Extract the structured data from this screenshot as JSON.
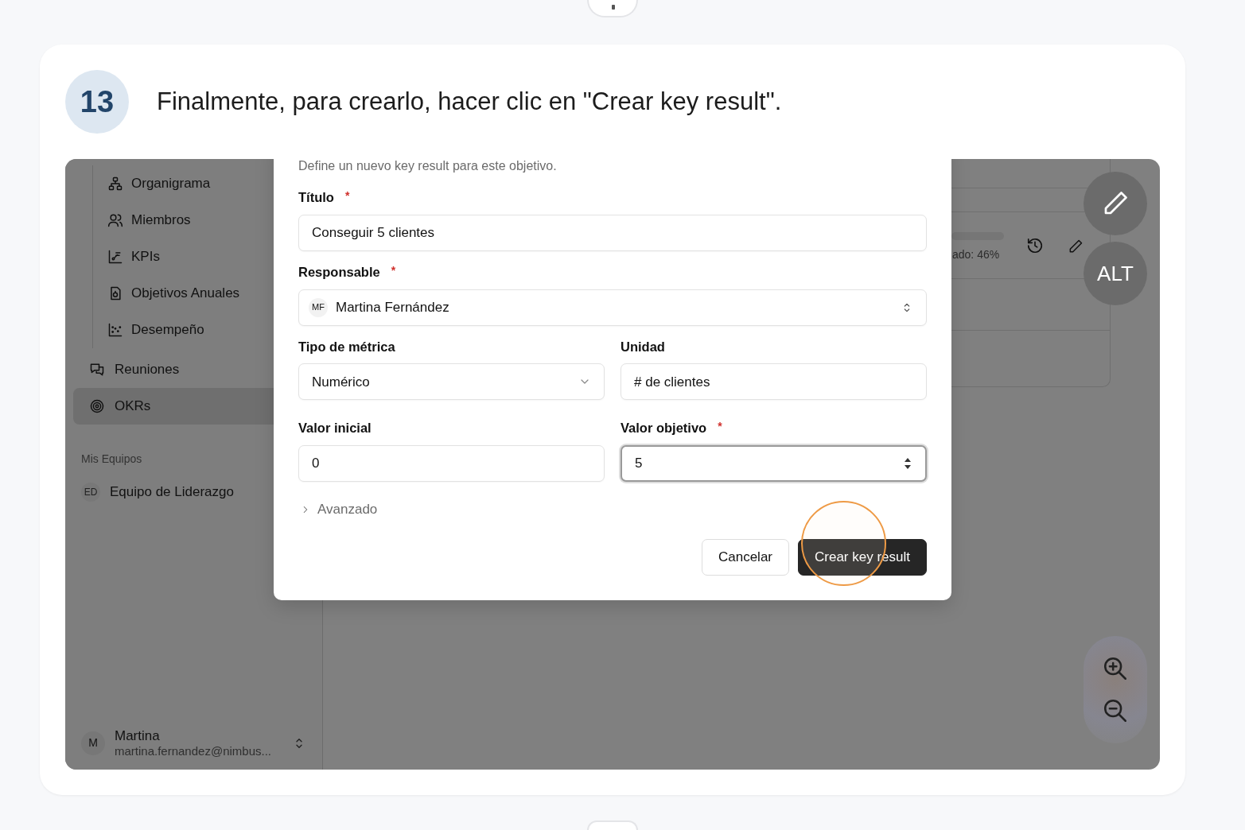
{
  "step": {
    "number": "13",
    "text": "Finalmente, para crearlo, hacer clic en \"Crear key result\"."
  },
  "sidebar": {
    "sub_items": [
      {
        "label": "Organigrama"
      },
      {
        "label": "Miembros"
      },
      {
        "label": "KPIs"
      },
      {
        "label": "Objetivos Anuales"
      },
      {
        "label": "Desempeño"
      }
    ],
    "items": [
      {
        "label": "Reuniones",
        "selected": false
      },
      {
        "label": "OKRs",
        "selected": true
      }
    ],
    "section_title": "Mis Equipos",
    "teams": [
      {
        "initials": "ED",
        "name": "Equipo de Liderazgo"
      }
    ],
    "user": {
      "initial": "M",
      "name": "Martina",
      "email": "martina.fernandez@nimbus..."
    }
  },
  "background": {
    "progress_text": "ado: 46%"
  },
  "dialog": {
    "description": "Define un nuevo key result para este objetivo.",
    "required_marker": "*",
    "rows": [
      {
        "fields": [
          {
            "label": "Título",
            "required": true,
            "kind": "text",
            "value": "Conseguir 5 clientes",
            "focused": false
          }
        ]
      },
      {
        "fields": [
          {
            "label": "Responsable",
            "required": true,
            "kind": "combo",
            "avatar": "MF",
            "value": "Martina Fernández",
            "focused": false
          }
        ]
      },
      {
        "fields": [
          {
            "label": "Tipo de métrica",
            "required": false,
            "kind": "select",
            "value": "Numérico",
            "focused": false
          },
          {
            "label": "Unidad",
            "required": false,
            "kind": "text",
            "value": "# de clientes",
            "focused": false
          }
        ]
      },
      {
        "fields": [
          {
            "label": "Valor inicial",
            "required": false,
            "kind": "text",
            "value": "0",
            "focused": false
          },
          {
            "label": "Valor objetivo",
            "required": true,
            "kind": "number",
            "value": "5",
            "focused": true
          }
        ]
      }
    ],
    "advanced": {
      "label": "Avanzado",
      "expanded": false
    },
    "buttons": [
      {
        "label": "Cancelar",
        "kind": "secondary"
      },
      {
        "label": "Crear key result",
        "kind": "primary"
      }
    ]
  },
  "overlay": {
    "alt_label": "ALT"
  }
}
